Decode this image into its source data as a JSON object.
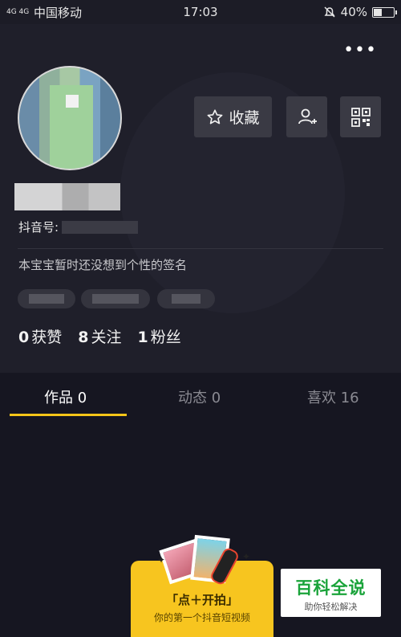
{
  "status_bar": {
    "signal": "4G 4G",
    "carrier": "中国移动",
    "time": "17:03",
    "battery": "40%",
    "battery_level": 0.4
  },
  "profile": {
    "id_label": "抖音号:",
    "signature": "本宝宝暂时还没想到个性的签名",
    "favorite_label": "收藏",
    "stats": [
      {
        "num": "0",
        "label": "获赞"
      },
      {
        "num": "8",
        "label": "关注"
      },
      {
        "num": "1",
        "label": "粉丝"
      }
    ]
  },
  "tabs": [
    {
      "label": "作品 0"
    },
    {
      "label": "动态 0"
    },
    {
      "label": "喜欢 16"
    }
  ],
  "shoot_card": {
    "title": "「点＋开拍」",
    "subtitle": "你的第一个抖音短视频"
  },
  "watermark": {
    "title": "百科全说",
    "subtitle": "助你轻松解决"
  },
  "colors": {
    "accent": "#f5c518",
    "background": "#161621"
  }
}
